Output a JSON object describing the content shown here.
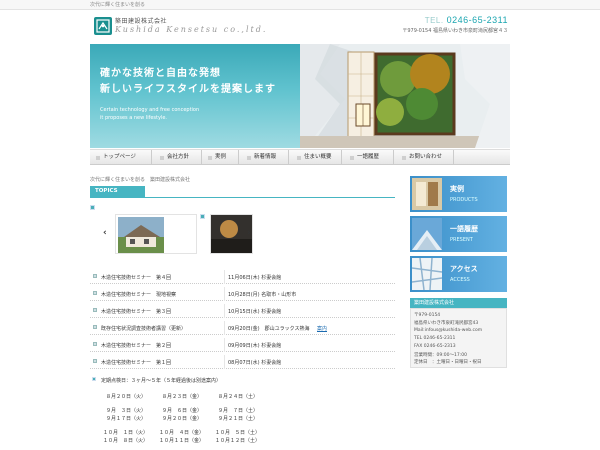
{
  "top": {
    "tagline": "次代に輝く住まいを創る"
  },
  "header": {
    "company_jp": "築田建設株式会社",
    "company_en": "Kushida Kensetsu co.,ltd.",
    "tel_label": "TEL.",
    "tel": "0246-65-2311",
    "address": "〒979-0154 福島県いわき市泉町滝尻都宮４３"
  },
  "hero": {
    "title1": "確かな技術と自由な発想",
    "title2": "新しいライフスタイルを提案します",
    "en1": "Certain technology and free conception",
    "en2": "it proposes a new lifestyle."
  },
  "nav": {
    "items": [
      "トップページ",
      "会社方針",
      "実例",
      "新着情報",
      "住まい概要",
      "一語履歴",
      "お問い合わせ"
    ]
  },
  "breadcrumb": "次代に輝く住まいを創る　築田建設株式会社",
  "topics": {
    "label": "TOPICS"
  },
  "news": [
    {
      "title": "木造住宅技術セミナー　第４回",
      "date": "11月06日(木) 杉妻会館",
      "link": ""
    },
    {
      "title": "木造住宅技術セミナー　現地視察",
      "date": "10月28日(月) 名取市・山形市",
      "link": ""
    },
    {
      "title": "木造住宅技術セミナー　第３回",
      "date": "10月15日(水) 杉妻会館",
      "link": ""
    },
    {
      "title": "既存住宅状況調査技術者講習（更新）",
      "date": "09月20日(金)　郡山ユラックス熱海",
      "link": "案内"
    },
    {
      "title": "木造住宅技術セミナー　第２回",
      "date": "09月09日(木) 杉妻会館",
      "link": ""
    },
    {
      "title": "木造住宅技術セミナー　第１回",
      "date": "08月07日(水) 杉妻会館",
      "link": ""
    }
  ],
  "schedule": {
    "title": "定期点検日：３ヶ月～５年（５年経過後は別途案内）",
    "rows": [
      [
        "８月２０日（火）",
        "８月２３日（金）",
        "８月２４日（土）"
      ],
      [
        "９月　３日（火）",
        "９月　６日（金）",
        "９月　７日（土）"
      ],
      [
        "９月１７日（火）",
        "９月２０日（金）",
        "９月２１日（土）"
      ],
      [
        "１０月　１日（火）",
        "１０月　４日（金）",
        "１０月　５日（土）"
      ],
      [
        "１０月　８日（火）",
        "１０月１１日（金）",
        "１０月１２日（土）"
      ]
    ]
  },
  "sidebar": {
    "banners": [
      {
        "jp": "実例",
        "en": "PRODUCTS"
      },
      {
        "jp": "一語履歴",
        "en": "PRESENT"
      },
      {
        "jp": "アクセス",
        "en": "ACCESS"
      }
    ],
    "company_head": "築田建設株式会社",
    "company_lines": [
      "〒979-0154",
      "福島県いわき市泉町滝尻都宮43",
      "Mail:infous@kushida-web.com",
      "TEL 0246-65-2311",
      "FAX 0246-65-2313",
      "営業時間：09:00～17:00",
      "定休日　：土曜日・日曜日・祝日"
    ]
  },
  "colors": {
    "accent": "#46b5c2",
    "banner": "#3b8fc9"
  }
}
